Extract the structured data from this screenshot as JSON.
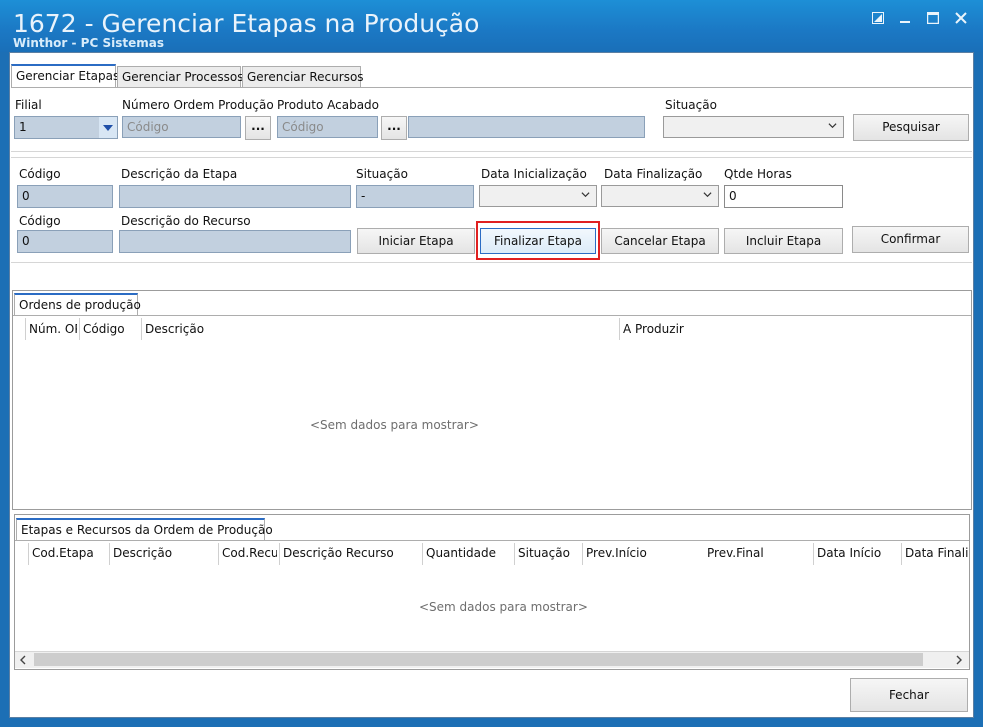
{
  "window": {
    "title": "1672 - Gerenciar Etapas na Produção",
    "subtitle": "Winthor - PC Sistemas",
    "controls": [
      "restore-down-icon",
      "minimize-icon",
      "maximize-icon",
      "close-icon"
    ]
  },
  "tabs": [
    {
      "label": "Gerenciar Etapas",
      "active": true
    },
    {
      "label": "Gerenciar Processos",
      "active": false
    },
    {
      "label": "Gerenciar Recursos",
      "active": false
    }
  ],
  "filter": {
    "filial_label": "Filial",
    "filial_value": "1",
    "ordem_label": "Número Ordem Produção",
    "ordem_placeholder": "Código",
    "produto_label": "Produto Acabado",
    "produto_placeholder": "Código",
    "situacao_label": "Situação",
    "situacao_value": "",
    "ellipsis": "...",
    "pesquisar": "Pesquisar"
  },
  "etapa": {
    "codigo_label": "Código",
    "codigo_value": "0",
    "descricao_label": "Descrição da Etapa",
    "descricao_value": "",
    "situacao_label": "Situação",
    "situacao_value": "-",
    "data_ini_label": "Data Inicialização",
    "data_fin_label": "Data Finalização",
    "qtde_label": "Qtde Horas",
    "qtde_value": "0"
  },
  "recurso": {
    "codigo_label": "Código",
    "codigo_value": "0",
    "descricao_label": "Descrição do Recurso",
    "descricao_value": ""
  },
  "actions": {
    "iniciar": "Iniciar Etapa",
    "finalizar": "Finalizar Etapa",
    "cancelar": "Cancelar Etapa",
    "incluir": "Incluir Etapa",
    "confirmar": "Confirmar"
  },
  "ordens": {
    "tab": "Ordens de produção",
    "columns": [
      "Núm. OP",
      "Código",
      "Descrição",
      "A Produzir"
    ],
    "empty": "<Sem dados para mostrar>"
  },
  "etapas_recursos": {
    "tab": "Etapas e Recursos da Ordem de Produção",
    "columns": [
      "Cod.Etapa",
      "Descrição",
      "Cod.Recurso",
      "Descrição Recurso",
      "Quantidade",
      "Situação",
      "Prev.Início",
      "Prev.Final",
      "Data Início",
      "Data Finalização"
    ],
    "empty": "<Sem dados para mostrar>"
  },
  "footer": {
    "fechar": "Fechar"
  }
}
